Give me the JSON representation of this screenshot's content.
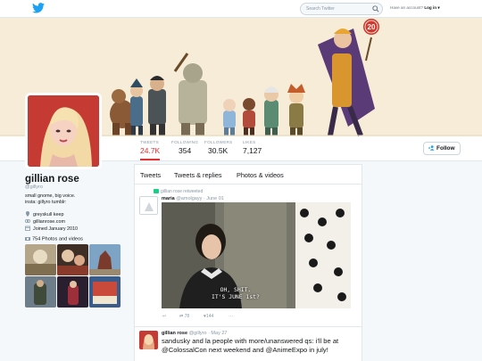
{
  "nav": {
    "search_placeholder": "Search Twitter",
    "have_account": "Have an account?",
    "login": "Log in ▾"
  },
  "profile": {
    "stats": [
      {
        "label": "TWEETS",
        "value": "24.7K"
      },
      {
        "label": "FOLLOWING",
        "value": "354"
      },
      {
        "label": "FOLLOWERS",
        "value": "30.5K"
      },
      {
        "label": "LIKES",
        "value": "7,127"
      }
    ],
    "follow_label": "Follow",
    "name": "gillian rose",
    "handle": "@gillyro",
    "bio_line1": "small gnome, big voice.",
    "bio_line2": "insta: gillyro tumblr:",
    "location": "greyskull keep",
    "website": "gillianrose.com",
    "joined": "Joined January 2010",
    "photos_label": "754 Photos and videos"
  },
  "banner_sign": "20",
  "timeline": {
    "tabs": [
      "Tweets",
      "Tweets & replies",
      "Photos & videos"
    ],
    "retweeted_label": "gillian rose retweeted",
    "tweet1": {
      "name": "maria",
      "handle": "@amolgayy",
      "date": "· June 01",
      "caption_line1": "OH, SHIT.",
      "caption_line2": "IT'S JUNE 1st?",
      "retweets": "78",
      "likes": "144",
      "more": "···"
    },
    "tweet2": {
      "name": "gillian rose",
      "handle": "@gillyro",
      "date": "· May 27",
      "text_part1": "sandusky and la people with more/unanswered qs: i'll be at ",
      "mention1": "@ColossalCon",
      "text_part2": " next weekend and ",
      "mention2": "@AnimeExpo",
      "text_part3": " in july!"
    }
  },
  "colors": {
    "accent": "#1da1f2",
    "active_stat": "#dd3333",
    "banner": "#f6ecd7"
  }
}
